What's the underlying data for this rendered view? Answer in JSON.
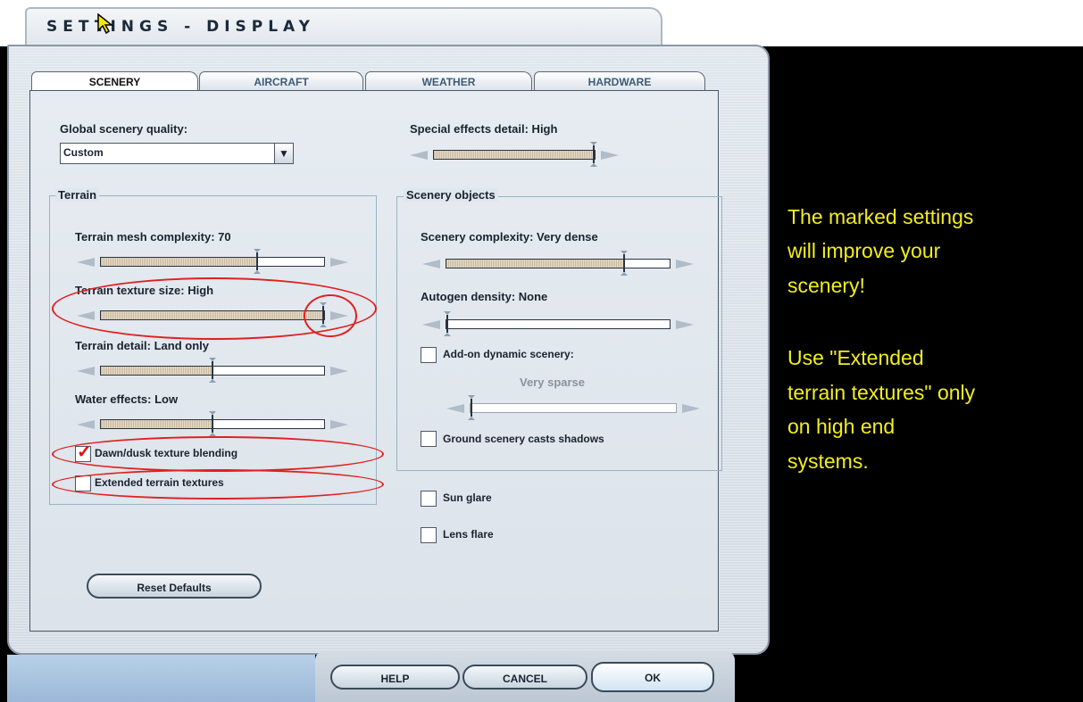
{
  "window": {
    "title": "SETTINGS - DISPLAY"
  },
  "tabs": [
    {
      "label": "SCENERY",
      "active": true
    },
    {
      "label": "AIRCRAFT",
      "active": false
    },
    {
      "label": "WEATHER",
      "active": false
    },
    {
      "label": "HARDWARE",
      "active": false
    }
  ],
  "global": {
    "label": "Global scenery quality:",
    "selected": "Custom"
  },
  "special_effects": {
    "label": "Special effects detail: High",
    "value": 1.0
  },
  "terrain": {
    "title": "Terrain",
    "mesh": {
      "label": "Terrain mesh complexity: 70",
      "value": 0.7
    },
    "texture": {
      "label": "Terrain texture size: High",
      "value": 1.0
    },
    "detail": {
      "label": "Terrain detail: Land only",
      "value": 0.5
    },
    "water": {
      "label": "Water effects: Low",
      "value": 0.5
    },
    "dawn_dusk": {
      "label": "Dawn/dusk texture blending",
      "checked": true
    },
    "extended": {
      "label": "Extended terrain textures",
      "checked": false
    }
  },
  "scenery_objects": {
    "title": "Scenery objects",
    "complexity": {
      "label": "Scenery complexity: Very dense",
      "value": 0.8
    },
    "autogen": {
      "label": "Autogen density: None",
      "value": 0.0
    },
    "addon": {
      "label": "Add-on dynamic scenery:",
      "checked": false,
      "value_label": "Very sparse",
      "value": 0.0
    },
    "ground_shadows": {
      "label": "Ground scenery casts shadows",
      "checked": false
    }
  },
  "sun_glare": {
    "label": "Sun glare",
    "checked": false
  },
  "lens_flare": {
    "label": "Lens flare",
    "checked": false
  },
  "buttons": {
    "reset": "Reset Defaults",
    "help": "HELP",
    "cancel": "CANCEL",
    "ok": "OK"
  },
  "annotation": {
    "line1": "The marked settings",
    "line2": "will improve your",
    "line3": "scenery!",
    "line4": "Use \"Extended",
    "line5": "terrain textures\" only",
    "line6": "on high end",
    "line7": "systems.",
    "color": "#f2ee1e",
    "marker_color": "#e02020"
  }
}
